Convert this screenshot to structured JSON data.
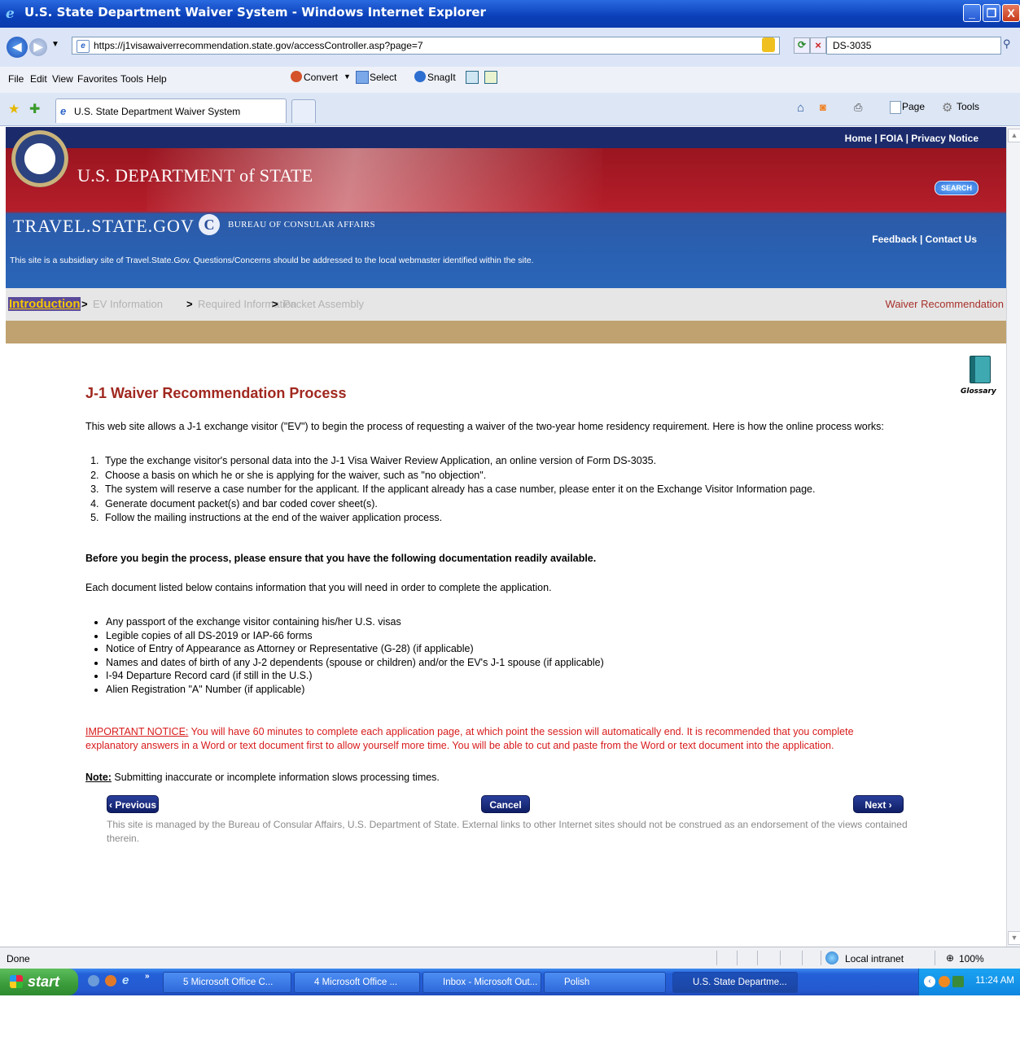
{
  "window": {
    "title": "U.S. State Department Waiver System - Windows Internet Explorer",
    "controls": [
      "_",
      "❐",
      "X"
    ]
  },
  "address": {
    "url": "https://j1visawaiverrecommendation.state.gov/accessController.asp?page=7",
    "search_value": "DS-3035"
  },
  "menu": {
    "items": [
      "File",
      "Edit",
      "View",
      "Favorites",
      "Tools",
      "Help"
    ],
    "toolbar": [
      "Convert",
      "Select",
      "SnagIt"
    ]
  },
  "tabs": {
    "active_label": "U.S. State Department Waiver System",
    "right_tools": [
      "Page",
      "Tools"
    ]
  },
  "banner": {
    "top_links": "Home | FOIA | Privacy Notice",
    "department": "U.S. DEPARTMENT of STATE",
    "site_name": "TRAVEL.STATE.GOV",
    "bureau": "BUREAU OF CONSULAR AFFAIRS",
    "search_label": "SEARCH",
    "feedback_links": "Feedback | Contact Us",
    "subsidiary_notice": "This site is a subsidiary site of Travel.State.Gov. Questions/Concerns should be addressed to the local webmaster identified within the site."
  },
  "progress": {
    "steps": [
      "Introduction",
      "EV Information",
      "Required Information",
      "Packet Assembly"
    ],
    "separator": ">",
    "right_label": "Waiver Recommendation"
  },
  "glossary": {
    "label": "Glossary"
  },
  "content": {
    "heading": "J-1 Waiver Recommendation Process",
    "intro": "This web site allows a J-1 exchange visitor (\"EV\") to begin the process of requesting a waiver of the two-year home residency requirement. Here is how the online process works:",
    "steps": [
      "Type the exchange visitor's personal data into the J-1 Visa Waiver Review Application, an online version of Form DS-3035.",
      "Choose a basis on which he or she is applying for the waiver, such as \"no objection\".",
      "The system will reserve a case number for the applicant. If the applicant already has a case number, please enter it on the Exchange Visitor Information page.",
      "Generate document packet(s) and bar coded cover sheet(s).",
      "Follow the mailing instructions at the end of the waiver application process."
    ],
    "before_begin": "Before you begin the process, please ensure that you have the following documentation readily available.",
    "each_document": "Each document listed below contains information that you will need in order to complete the application.",
    "documents": [
      "Any passport of the exchange visitor containing his/her U.S. visas",
      "Legible copies of all DS-2019 or IAP-66 forms",
      "Notice of Entry of Appearance as Attorney or Representative (G-28) (if applicable)",
      "Names and dates of birth of any J-2 dependents (spouse or children) and/or the EV's J-1 spouse (if applicable)",
      "I-94 Departure Record card (if still in the U.S.)",
      "Alien Registration \"A\" Number (if applicable)"
    ],
    "notice_label": "IMPORTANT NOTICE:",
    "notice_text": " You will have 60 minutes to complete each application page, at which point the session will automatically end. It is recommended that you complete explanatory answers in a Word or text document first to allow yourself more time. You will be able to cut and paste from the Word or text document into the application.",
    "note_label": "Note:",
    "note_text": " Submitting inaccurate or incomplete information slows processing times.",
    "buttons": {
      "previous": "‹ Previous",
      "cancel": "Cancel",
      "next": "Next ›"
    },
    "footer": "This site is managed by the Bureau of Consular Affairs, U.S. Department of State. External links to other Internet sites should not be construed as an endorsement of the views contained therein."
  },
  "statusbar": {
    "status": "Done",
    "zone": "Local intranet",
    "zoom": "100%"
  },
  "taskbar": {
    "start": "start",
    "tasks": [
      "5 Microsoft Office C...",
      "4 Microsoft Office ...",
      "Inbox - Microsoft Out...",
      "Polish",
      "U.S. State Departme..."
    ],
    "clock": "11:24 AM"
  },
  "colors": {
    "heading": "#a0281f",
    "notice": "#d81b1b",
    "banner_red": "#b51e2a",
    "banner_blue": "#2a66b9",
    "progress_bar_gold": "#bfa26f",
    "button_navy": "#1a2b7a"
  }
}
